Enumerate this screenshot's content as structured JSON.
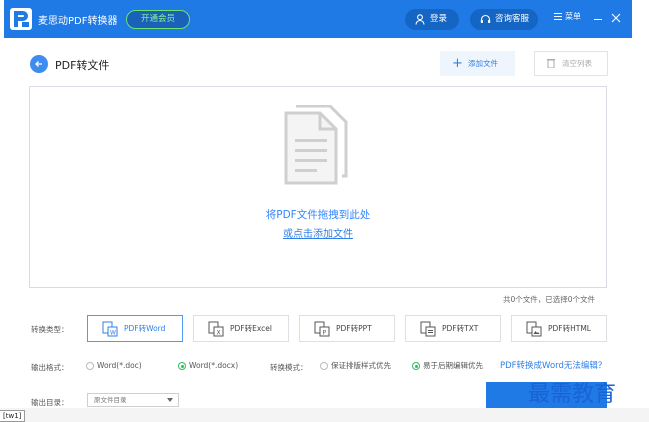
{
  "titlebar": {
    "app_title": "麦思动PDF转换器",
    "vip_button": "开通会员",
    "login_button": "登录",
    "service_button": "咨询客服",
    "menu_button": "菜单"
  },
  "header": {
    "page_title": "PDF转文件",
    "add_file": "添加文件",
    "clear_list": "清空列表"
  },
  "dropzone": {
    "drag_text": "将PDF文件拖拽到此处",
    "click_text": "或点击添加文件"
  },
  "file_count": "共0个文件，已选择0个文件",
  "conversion": {
    "label": "转换类型：",
    "types": [
      {
        "label": "PDF转Word",
        "icon": "word-file-icon",
        "active": true
      },
      {
        "label": "PDF转Excel",
        "icon": "excel-file-icon",
        "active": false
      },
      {
        "label": "PDF转PPT",
        "icon": "ppt-file-icon",
        "active": false
      },
      {
        "label": "PDF转TXT",
        "icon": "txt-file-icon",
        "active": false
      },
      {
        "label": "PDF转HTML",
        "icon": "html-file-icon",
        "active": false
      }
    ]
  },
  "output_format": {
    "label": "输出格式：",
    "options": [
      {
        "label": "Word(*.doc)",
        "checked": false
      },
      {
        "label": "Word(*.docx)",
        "checked": true
      }
    ]
  },
  "conversion_mode": {
    "label": "转换模式：",
    "options": [
      {
        "label": "保证排版样式优先",
        "checked": false
      },
      {
        "label": "易于后期编辑优先",
        "checked": true
      }
    ]
  },
  "help_link": "PDF转换成Word无法编辑？",
  "output_dir": {
    "label": "输出目录：",
    "selected": "原文件目录"
  },
  "watermark": "最需教育",
  "taskbar_item": "[tw1]"
}
